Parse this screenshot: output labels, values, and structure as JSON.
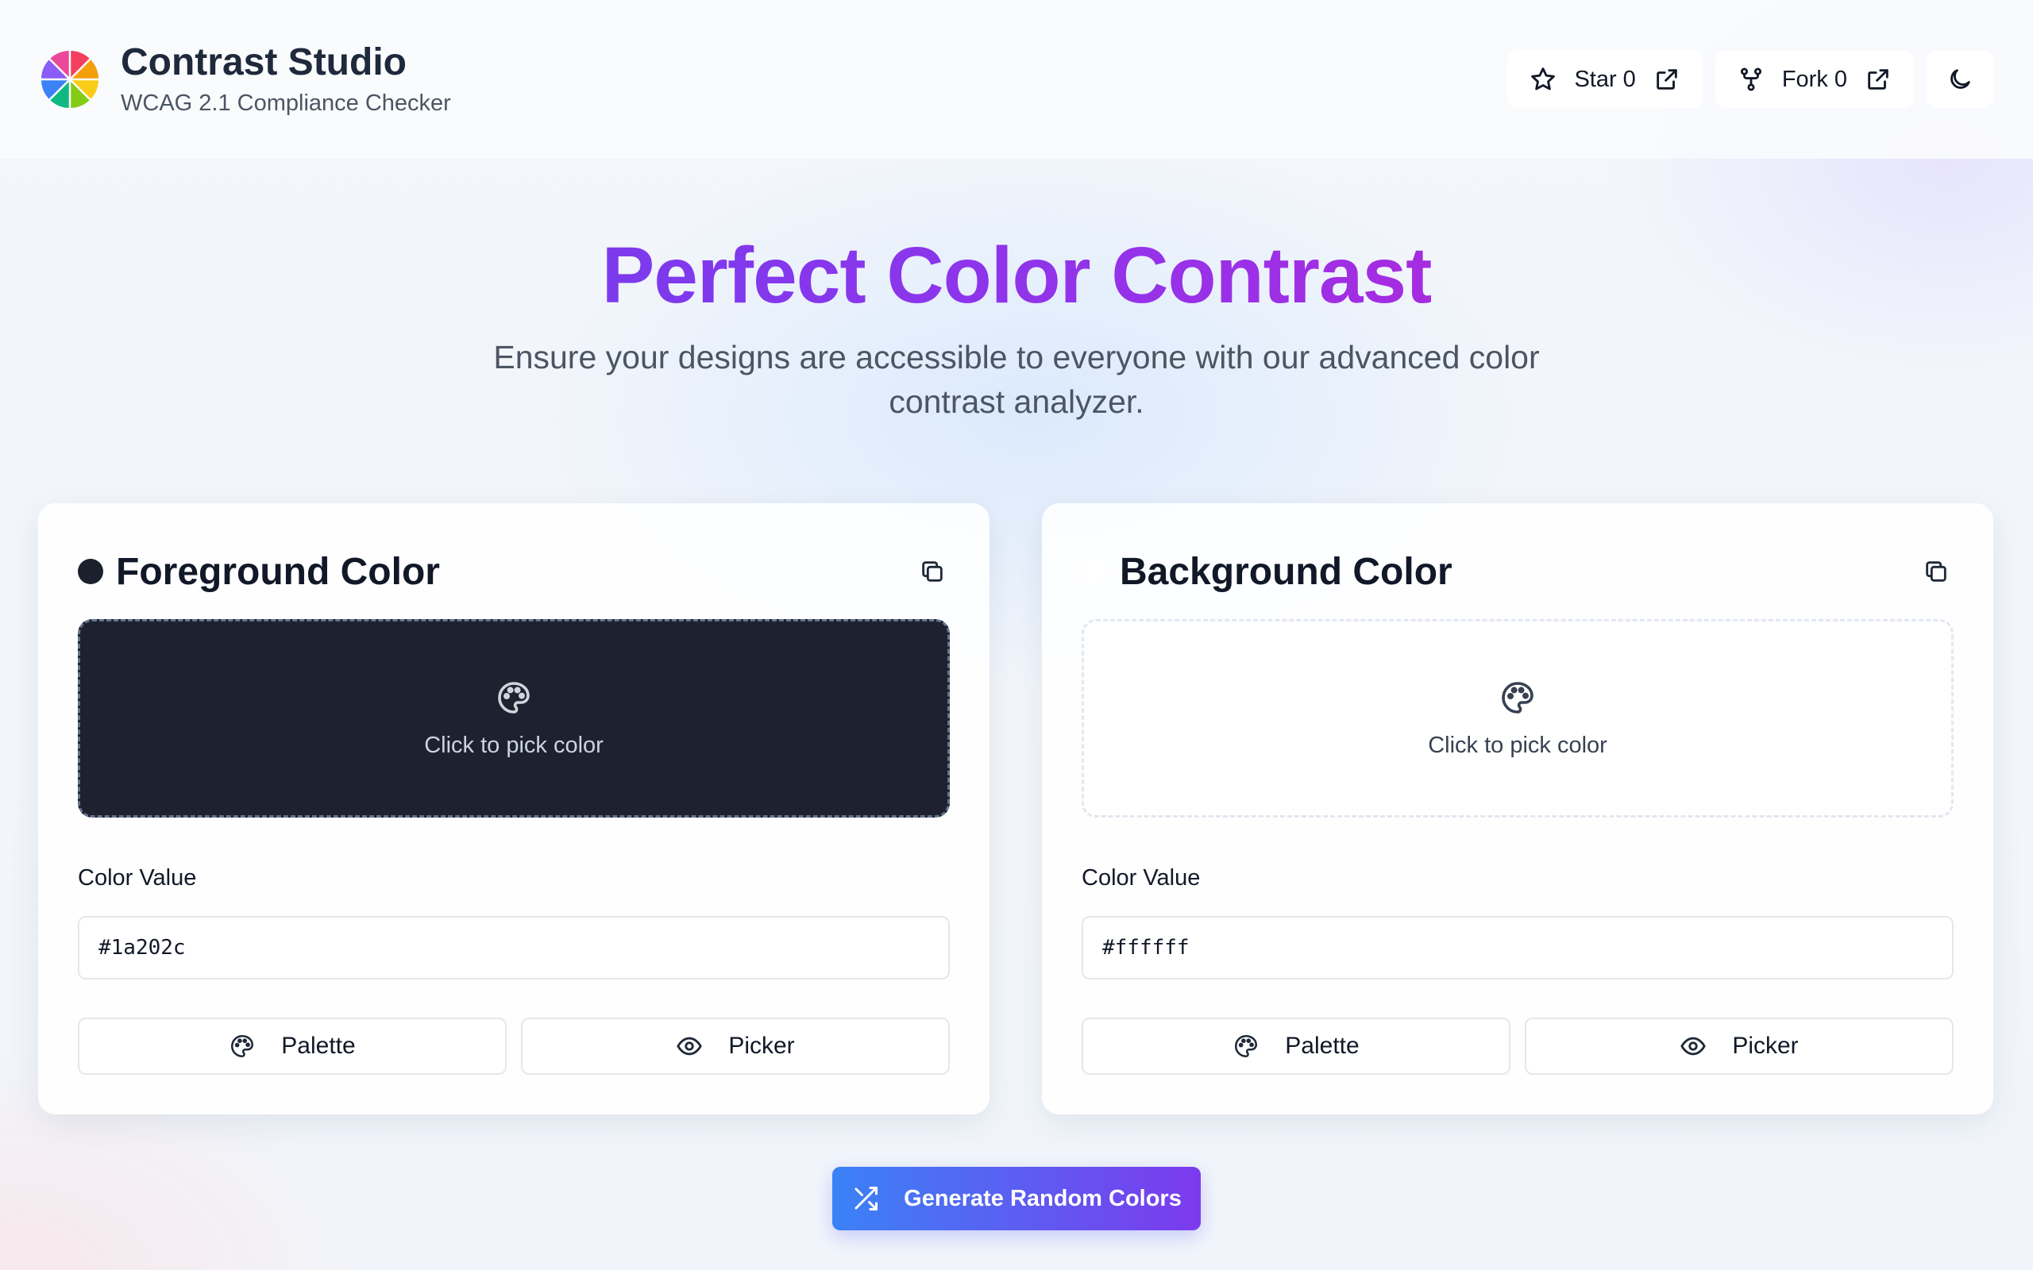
{
  "app": {
    "title": "Contrast Studio",
    "subtitle": "WCAG 2.1 Compliance Checker",
    "logo_icon": "color-wheel-icon"
  },
  "header": {
    "star_label": "Star 0",
    "fork_label": "Fork 0",
    "theme_toggle_icon": "moon-icon"
  },
  "hero": {
    "title": "Perfect Color Contrast",
    "subtitle": "Ensure your designs are accessible to everyone with our advanced color contrast analyzer."
  },
  "foreground": {
    "title": "Foreground Color",
    "color": "#1a202c",
    "swatch_text": "Click to pick color",
    "value_label": "Color Value",
    "value": "#1a202c",
    "palette_label": "Palette",
    "picker_label": "Picker"
  },
  "background": {
    "title": "Background Color",
    "color": "#ffffff",
    "swatch_text": "Click to pick color",
    "value_label": "Color Value",
    "value": "#ffffff",
    "palette_label": "Palette",
    "picker_label": "Picker"
  },
  "actions": {
    "generate_label": "Generate Random Colors"
  },
  "colors": {
    "accent_gradient_start": "#3b82f6",
    "accent_gradient_end": "#7c3aed",
    "hero_gradient": "#7c3aed"
  }
}
